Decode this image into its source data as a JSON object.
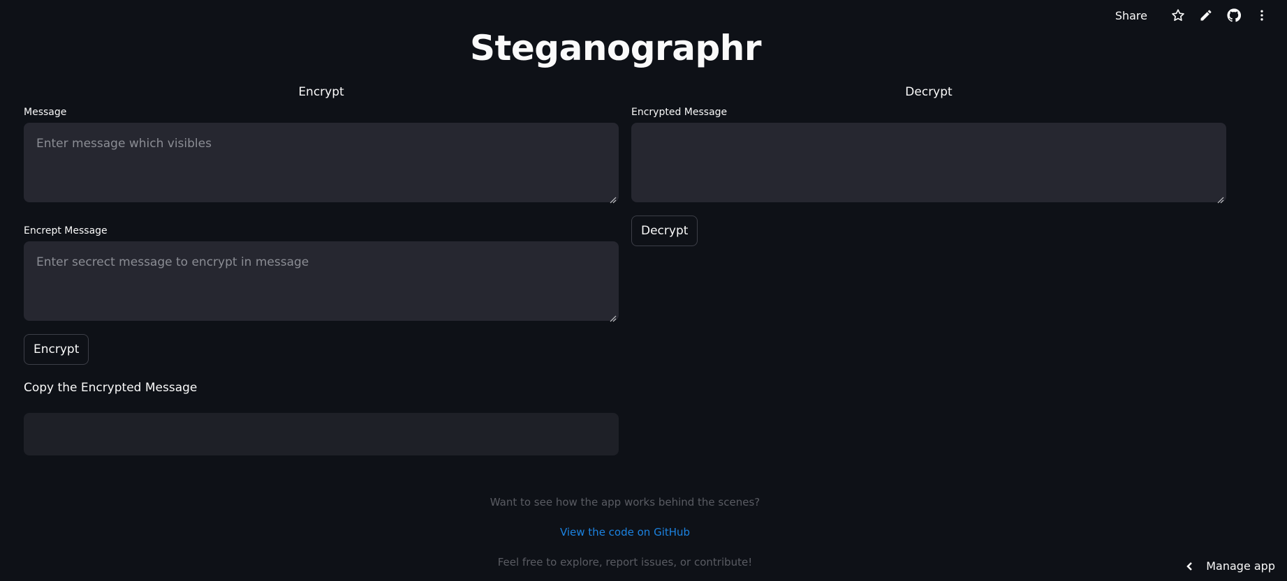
{
  "toolbar": {
    "share_label": "Share",
    "icons": [
      "star-icon",
      "pencil-icon",
      "github-icon",
      "more-vertical-icon"
    ]
  },
  "title": "Steganographr",
  "encrypt": {
    "heading": "Encrypt",
    "message_label": "Message",
    "message_placeholder": "Enter message which visibles",
    "secret_label": "Encrept Message",
    "secret_placeholder": "Enter secrect message to encrypt in message",
    "button_label": "Encrypt",
    "copy_label": "Copy the Encrypted Message"
  },
  "decrypt": {
    "heading": "Decrypt",
    "encrypted_label": "Encrypted Message",
    "encrypted_placeholder": "",
    "button_label": "Decrypt"
  },
  "footer": {
    "line1": "Want to see how the app works behind the scenes?",
    "link": "View the code on GitHub",
    "line3": "Feel free to explore, report issues, or contribute!"
  },
  "manage_app": {
    "label": "Manage app"
  },
  "colors": {
    "background": "#0e1117",
    "input_bg": "#262730",
    "link": "#1c83e1"
  }
}
